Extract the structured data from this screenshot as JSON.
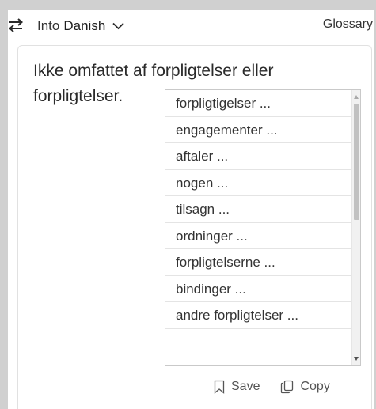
{
  "header": {
    "swap_icon": "swap-arrows-icon",
    "target_prefix": "Into",
    "target_language": "Danish",
    "glossary_label": "Glossary"
  },
  "translation": {
    "text": "Ikke omfattet af forpligtelser eller forpligtelser."
  },
  "alternatives": [
    "forpligtigelser ...",
    "engagementer ...",
    "aftaler ...",
    "nogen ...",
    "tilsagn ...",
    "ordninger ...",
    "forpligtelserne ...",
    "bindinger ...",
    "andre forpligtelser ..."
  ],
  "actions": {
    "save_label": "Save",
    "copy_label": "Copy"
  },
  "colors": {
    "frame": "#d0d0d0",
    "text": "#2b2b2b",
    "border": "#c9c9c9"
  }
}
